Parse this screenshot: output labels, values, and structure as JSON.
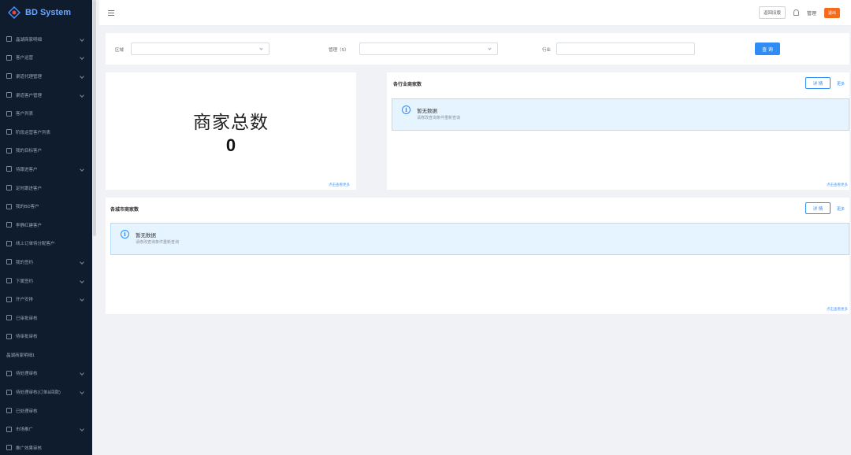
{
  "app": {
    "name": "BD System"
  },
  "sidebar": {
    "items": [
      {
        "label": "晶湖商家明细",
        "icon": "grid-icon",
        "expandable": true
      },
      {
        "label": "客户运营",
        "icon": "users-icon",
        "expandable": true
      },
      {
        "label": "渠道代理管理",
        "icon": "setting-icon",
        "expandable": true
      },
      {
        "label": "渠道客户管理",
        "icon": "setting-icon",
        "expandable": true
      },
      {
        "label": "客户列表",
        "icon": "list-icon",
        "expandable": false
      },
      {
        "label": "阶段运营客户列表",
        "icon": "list-icon",
        "expandable": false
      },
      {
        "label": "我的目标客户",
        "icon": "target-icon",
        "expandable": false
      },
      {
        "label": "待跟进客户",
        "icon": "clock-icon",
        "expandable": true
      },
      {
        "label": "定时跟进客户",
        "icon": "clock-icon",
        "expandable": false
      },
      {
        "label": "我的BD客户",
        "icon": "user-icon",
        "expandable": false
      },
      {
        "label": "李静红建客户",
        "icon": "user-icon",
        "expandable": false
      },
      {
        "label": "线上订单待分配客户",
        "icon": "order-icon",
        "expandable": false
      },
      {
        "label": "我的签约",
        "icon": "doc-icon",
        "expandable": true
      },
      {
        "label": "下属签约",
        "icon": "doc-icon",
        "expandable": true
      },
      {
        "label": "开户安排",
        "icon": "setting-icon",
        "expandable": true
      },
      {
        "label": "已审批审核",
        "icon": "check-icon",
        "expandable": false
      },
      {
        "label": "待审批审核",
        "icon": "check-icon",
        "expandable": false
      },
      {
        "label": "晶湖商家明细1",
        "icon": "",
        "expandable": false
      },
      {
        "label": "待处理审核",
        "icon": "flow-icon",
        "expandable": true
      },
      {
        "label": "待处理审核(订单&回款)",
        "icon": "flow-icon",
        "expandable": true
      },
      {
        "label": "已处理审核",
        "icon": "table-icon",
        "expandable": false
      },
      {
        "label": "市场推广",
        "icon": "folder-icon",
        "expandable": true
      },
      {
        "label": "推广效果审核",
        "icon": "chart-icon",
        "expandable": false
      }
    ]
  },
  "header": {
    "back_button": "返回旧版",
    "username": "管理",
    "badge": "退出"
  },
  "filter": {
    "area_label": "区域",
    "manager_label": "管理（S）",
    "industry_label": "行业",
    "search_button": "查 询"
  },
  "stat_card": {
    "label": "商家总数",
    "value": "0",
    "footer": "点击查看更多"
  },
  "industry_card": {
    "title": "各行业商家数",
    "detail_button": "详 情",
    "more": "更多",
    "alert_title": "暂无数据",
    "alert_desc": "请修改查询条件重新查询",
    "footer": "点击查看更多"
  },
  "region_card": {
    "title": "各城市商家数",
    "detail_button": "详 情",
    "more": "更多",
    "alert_title": "暂无数据",
    "alert_desc": "请修改查询条件重新查询",
    "footer": "点击查看更多"
  },
  "colors": {
    "sidebar_bg": "#0f1c2e",
    "primary": "#2f8cf5",
    "alert_bg": "#e6f4ff",
    "badge": "#f56a1b"
  }
}
